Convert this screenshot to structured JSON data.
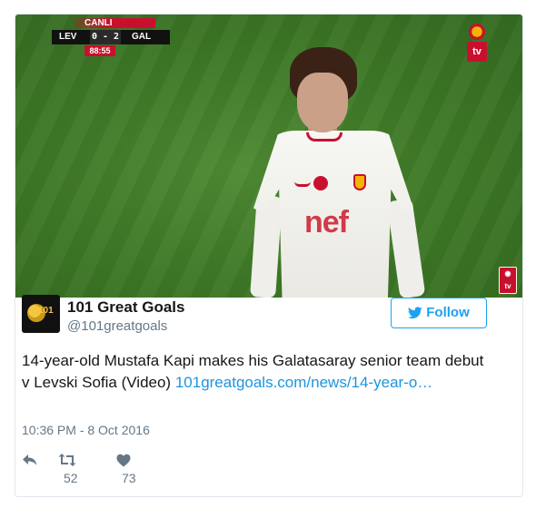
{
  "media": {
    "scorebug": {
      "live_label": "CANLI",
      "home_team": "LEV",
      "score": "0 - 2",
      "away_team": "GAL",
      "clock": "88:55"
    },
    "channel_logo_text": "tv",
    "shirt_sponsor": "nef"
  },
  "tweet": {
    "author_name": "101 Great Goals",
    "author_handle": "@101greatgoals",
    "follow_label": "Follow",
    "text": "14-year-old Mustafa Kapi makes his Galatasaray senior team debut v Levski Sofia (Video) ",
    "link_text": "101greatgoals.com/news/14-year-o…",
    "timestamp": "10:36 PM - 8 Oct 2016",
    "retweet_count": "52",
    "like_count": "73"
  },
  "avatar_logo_text": "101",
  "colors": {
    "accent": "#1da1f2",
    "link": "#1b95e0",
    "text": "#14171a",
    "muted": "#657786",
    "galatasaray_red": "#c8102e"
  }
}
